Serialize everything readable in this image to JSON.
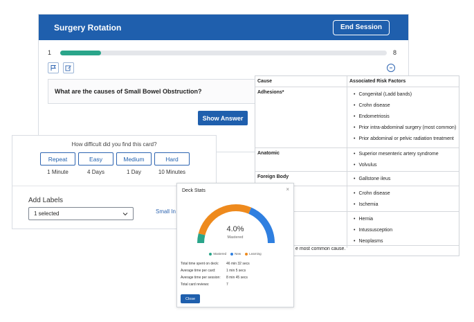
{
  "session": {
    "title": "Surgery Rotation",
    "end_label": "End Session",
    "progress_start": "1",
    "progress_end": "8",
    "progress_fraction": 0.125
  },
  "card": {
    "question": "What are the causes of Small Bowel Obstruction?",
    "show_answer_label": "Show Answer"
  },
  "answer_table": {
    "col_cause": "Cause",
    "col_factors": "Associated Risk Factors",
    "rows": [
      {
        "cause": "Adhesions*",
        "factors": [
          "Congenital (Ladd bands)",
          "Crohn disease",
          "Endometriosis",
          "Prior intra-abdominal surgery (most common)",
          "Prior abdominal or pelvic radiation treatment"
        ]
      },
      {
        "cause": "Anatomic",
        "factors": [
          "Superior mesenteric artery syndrome",
          "Volvulus"
        ]
      },
      {
        "cause": "Foreign Body",
        "factors": [
          "Gallstone ileus"
        ]
      },
      {
        "cause": "",
        "factors": [
          "Crohn disease",
          "Ischemia"
        ]
      },
      {
        "cause": "",
        "factors": [
          "Hernia",
          "Intussusception",
          "Neoplasms"
        ]
      }
    ],
    "footnote": "e most common cause."
  },
  "difficulty": {
    "question": "How difficult did you find this card?",
    "options": [
      {
        "label": "Repeat",
        "interval": "1 Minute"
      },
      {
        "label": "Easy",
        "interval": "4 Days"
      },
      {
        "label": "Medium",
        "interval": "1 Day"
      },
      {
        "label": "Hard",
        "interval": "10 Minutes"
      }
    ],
    "add_labels": "Add Labels",
    "select_value": "1 selected",
    "small_link": "Small In"
  },
  "deck_stats": {
    "title": "Deck Stats",
    "close_x": "×",
    "percent": "4.0%",
    "percent_label": "Mastered",
    "segments": [
      {
        "name": "Mastered",
        "fraction": 0.08,
        "color": "#2aa58a"
      },
      {
        "name": "Learning",
        "fraction": 0.55,
        "color": "#ee8a1d"
      },
      {
        "name": "New",
        "fraction": 0.37,
        "color": "#2f7fe0"
      }
    ],
    "legend": [
      {
        "name": "Mastered",
        "color": "#2aa58a"
      },
      {
        "name": "New",
        "color": "#2f7fe0"
      },
      {
        "name": "Learning",
        "color": "#ee8a1d"
      }
    ],
    "stats": [
      {
        "label": "Total time spent on deck:",
        "value": "46 min  32 secs"
      },
      {
        "label": "Average time per card:",
        "value": "1 min   5 secs"
      },
      {
        "label": "Average time per session:",
        "value": "8 min  45 secs"
      },
      {
        "label": "Total card reviews:",
        "value": "7"
      }
    ],
    "close_label": "Close"
  },
  "colors": {
    "primary": "#1f5fad",
    "progress": "#2aa58a",
    "learning": "#ee8a1d",
    "new": "#2f7fe0"
  },
  "icons": [
    "flag-icon",
    "edit-icon",
    "collapse-icon",
    "chevron-down-icon",
    "close-icon"
  ]
}
